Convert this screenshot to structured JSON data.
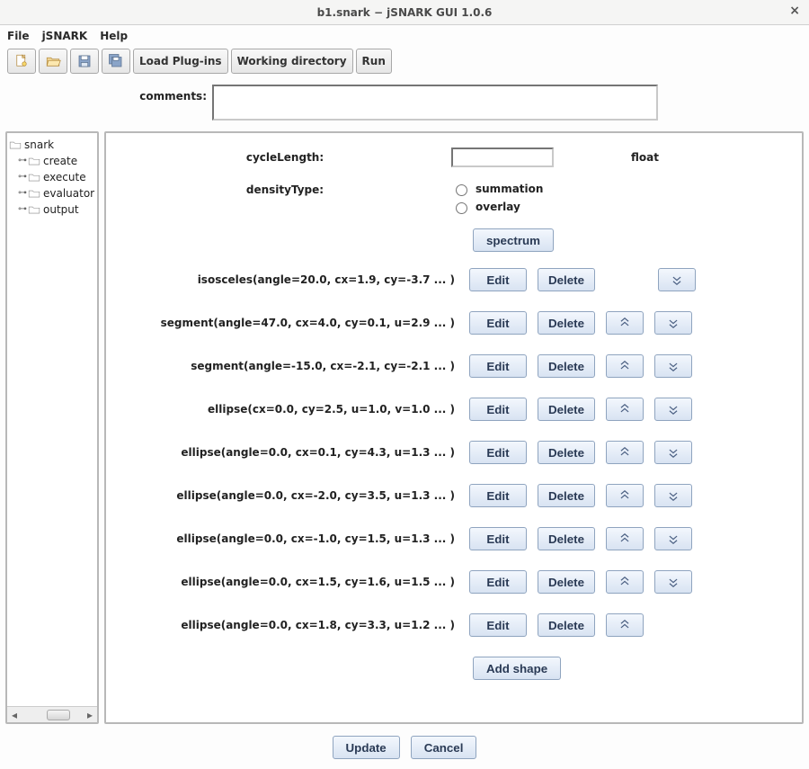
{
  "window": {
    "title": "b1.snark − jSNARK GUI 1.0.6"
  },
  "menu": {
    "file": "File",
    "jsnark": "jSNARK",
    "help": "Help"
  },
  "toolbar": {
    "load_plugins": "Load Plug-ins",
    "working_dir": "Working directory",
    "run": "Run"
  },
  "comments": {
    "label": "comments:",
    "value": ""
  },
  "tree": {
    "root": "snark",
    "children": [
      "create",
      "execute",
      "evaluator",
      "output"
    ]
  },
  "form": {
    "cycle_label": "cycleLength:",
    "cycle_value": "",
    "cycle_note": "float",
    "density_label": "densityType:",
    "density_opts": [
      "summation",
      "overlay"
    ],
    "spectrum": "spectrum",
    "add_shape": "Add shape"
  },
  "buttons": {
    "edit": "Edit",
    "delete": "Delete"
  },
  "shapes": [
    {
      "label": "isosceles(angle=20.0, cx=1.9, cy=-3.7 ... )",
      "up": false,
      "down": true
    },
    {
      "label": "segment(angle=47.0, cx=4.0, cy=0.1, u=2.9 ... )",
      "up": true,
      "down": true
    },
    {
      "label": "segment(angle=-15.0, cx=-2.1, cy=-2.1 ... )",
      "up": true,
      "down": true
    },
    {
      "label": "ellipse(cx=0.0, cy=2.5, u=1.0, v=1.0 ... )",
      "up": true,
      "down": true
    },
    {
      "label": "ellipse(angle=0.0, cx=0.1, cy=4.3, u=1.3 ... )",
      "up": true,
      "down": true
    },
    {
      "label": "ellipse(angle=0.0, cx=-2.0, cy=3.5, u=1.3 ... )",
      "up": true,
      "down": true
    },
    {
      "label": "ellipse(angle=0.0, cx=-1.0, cy=1.5, u=1.3 ... )",
      "up": true,
      "down": true
    },
    {
      "label": "ellipse(angle=0.0, cx=1.5, cy=1.6, u=1.5 ... )",
      "up": true,
      "down": true
    },
    {
      "label": "ellipse(angle=0.0, cx=1.8, cy=3.3, u=1.2 ... )",
      "up": true,
      "down": false
    }
  ],
  "footer": {
    "update": "Update",
    "cancel": "Cancel"
  }
}
